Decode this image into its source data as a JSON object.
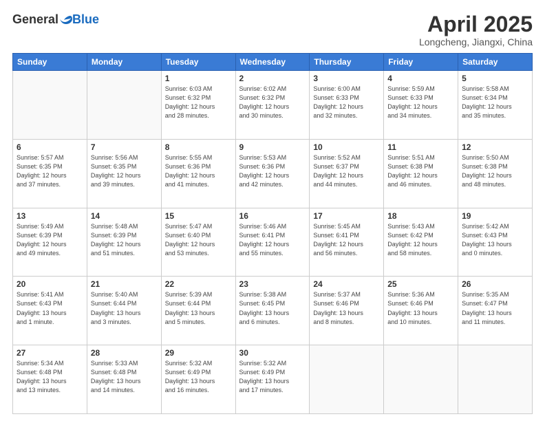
{
  "logo": {
    "general": "General",
    "blue": "Blue"
  },
  "header": {
    "month_title": "April 2025",
    "location": "Longcheng, Jiangxi, China"
  },
  "days_of_week": [
    "Sunday",
    "Monday",
    "Tuesday",
    "Wednesday",
    "Thursday",
    "Friday",
    "Saturday"
  ],
  "weeks": [
    [
      {
        "day": "",
        "info": ""
      },
      {
        "day": "",
        "info": ""
      },
      {
        "day": "1",
        "info": "Sunrise: 6:03 AM\nSunset: 6:32 PM\nDaylight: 12 hours\nand 28 minutes."
      },
      {
        "day": "2",
        "info": "Sunrise: 6:02 AM\nSunset: 6:32 PM\nDaylight: 12 hours\nand 30 minutes."
      },
      {
        "day": "3",
        "info": "Sunrise: 6:00 AM\nSunset: 6:33 PM\nDaylight: 12 hours\nand 32 minutes."
      },
      {
        "day": "4",
        "info": "Sunrise: 5:59 AM\nSunset: 6:33 PM\nDaylight: 12 hours\nand 34 minutes."
      },
      {
        "day": "5",
        "info": "Sunrise: 5:58 AM\nSunset: 6:34 PM\nDaylight: 12 hours\nand 35 minutes."
      }
    ],
    [
      {
        "day": "6",
        "info": "Sunrise: 5:57 AM\nSunset: 6:35 PM\nDaylight: 12 hours\nand 37 minutes."
      },
      {
        "day": "7",
        "info": "Sunrise: 5:56 AM\nSunset: 6:35 PM\nDaylight: 12 hours\nand 39 minutes."
      },
      {
        "day": "8",
        "info": "Sunrise: 5:55 AM\nSunset: 6:36 PM\nDaylight: 12 hours\nand 41 minutes."
      },
      {
        "day": "9",
        "info": "Sunrise: 5:53 AM\nSunset: 6:36 PM\nDaylight: 12 hours\nand 42 minutes."
      },
      {
        "day": "10",
        "info": "Sunrise: 5:52 AM\nSunset: 6:37 PM\nDaylight: 12 hours\nand 44 minutes."
      },
      {
        "day": "11",
        "info": "Sunrise: 5:51 AM\nSunset: 6:38 PM\nDaylight: 12 hours\nand 46 minutes."
      },
      {
        "day": "12",
        "info": "Sunrise: 5:50 AM\nSunset: 6:38 PM\nDaylight: 12 hours\nand 48 minutes."
      }
    ],
    [
      {
        "day": "13",
        "info": "Sunrise: 5:49 AM\nSunset: 6:39 PM\nDaylight: 12 hours\nand 49 minutes."
      },
      {
        "day": "14",
        "info": "Sunrise: 5:48 AM\nSunset: 6:39 PM\nDaylight: 12 hours\nand 51 minutes."
      },
      {
        "day": "15",
        "info": "Sunrise: 5:47 AM\nSunset: 6:40 PM\nDaylight: 12 hours\nand 53 minutes."
      },
      {
        "day": "16",
        "info": "Sunrise: 5:46 AM\nSunset: 6:41 PM\nDaylight: 12 hours\nand 55 minutes."
      },
      {
        "day": "17",
        "info": "Sunrise: 5:45 AM\nSunset: 6:41 PM\nDaylight: 12 hours\nand 56 minutes."
      },
      {
        "day": "18",
        "info": "Sunrise: 5:43 AM\nSunset: 6:42 PM\nDaylight: 12 hours\nand 58 minutes."
      },
      {
        "day": "19",
        "info": "Sunrise: 5:42 AM\nSunset: 6:43 PM\nDaylight: 13 hours\nand 0 minutes."
      }
    ],
    [
      {
        "day": "20",
        "info": "Sunrise: 5:41 AM\nSunset: 6:43 PM\nDaylight: 13 hours\nand 1 minute."
      },
      {
        "day": "21",
        "info": "Sunrise: 5:40 AM\nSunset: 6:44 PM\nDaylight: 13 hours\nand 3 minutes."
      },
      {
        "day": "22",
        "info": "Sunrise: 5:39 AM\nSunset: 6:44 PM\nDaylight: 13 hours\nand 5 minutes."
      },
      {
        "day": "23",
        "info": "Sunrise: 5:38 AM\nSunset: 6:45 PM\nDaylight: 13 hours\nand 6 minutes."
      },
      {
        "day": "24",
        "info": "Sunrise: 5:37 AM\nSunset: 6:46 PM\nDaylight: 13 hours\nand 8 minutes."
      },
      {
        "day": "25",
        "info": "Sunrise: 5:36 AM\nSunset: 6:46 PM\nDaylight: 13 hours\nand 10 minutes."
      },
      {
        "day": "26",
        "info": "Sunrise: 5:35 AM\nSunset: 6:47 PM\nDaylight: 13 hours\nand 11 minutes."
      }
    ],
    [
      {
        "day": "27",
        "info": "Sunrise: 5:34 AM\nSunset: 6:48 PM\nDaylight: 13 hours\nand 13 minutes."
      },
      {
        "day": "28",
        "info": "Sunrise: 5:33 AM\nSunset: 6:48 PM\nDaylight: 13 hours\nand 14 minutes."
      },
      {
        "day": "29",
        "info": "Sunrise: 5:32 AM\nSunset: 6:49 PM\nDaylight: 13 hours\nand 16 minutes."
      },
      {
        "day": "30",
        "info": "Sunrise: 5:32 AM\nSunset: 6:49 PM\nDaylight: 13 hours\nand 17 minutes."
      },
      {
        "day": "",
        "info": ""
      },
      {
        "day": "",
        "info": ""
      },
      {
        "day": "",
        "info": ""
      }
    ]
  ]
}
